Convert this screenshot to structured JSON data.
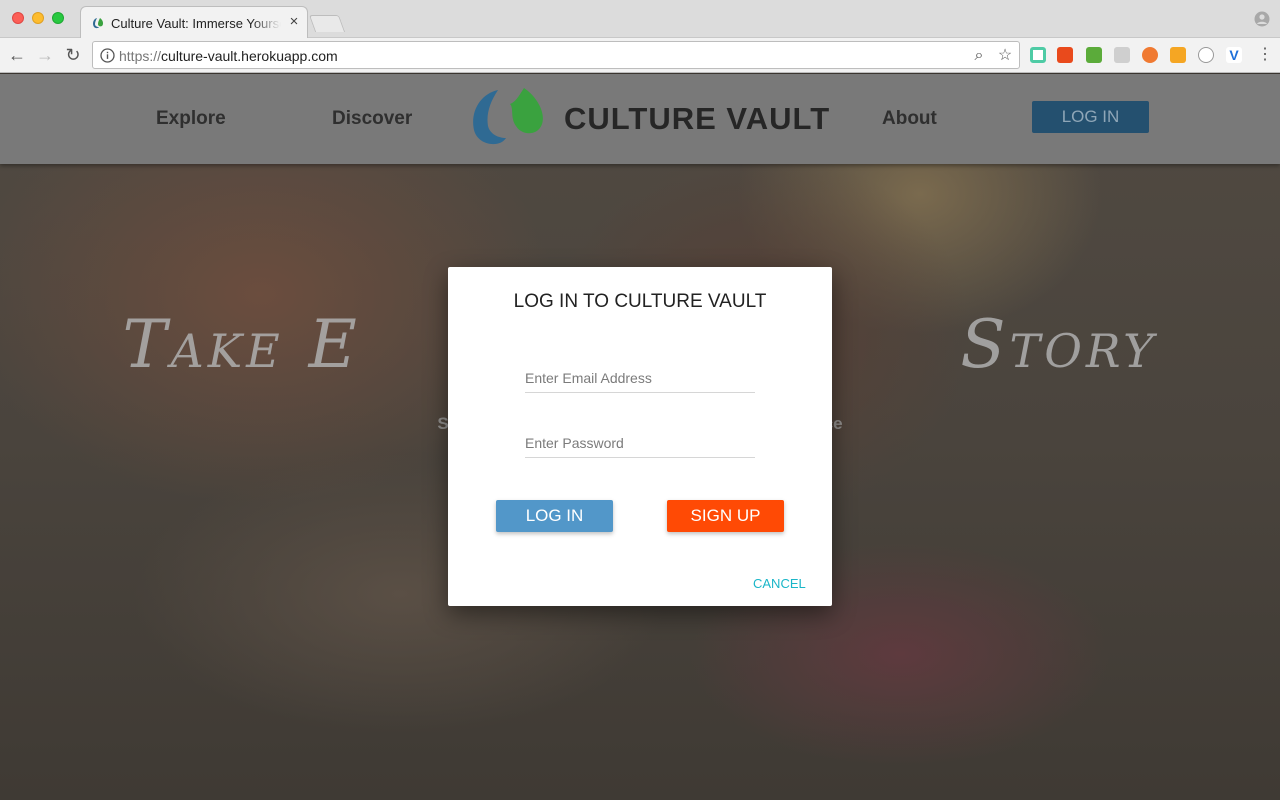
{
  "browser": {
    "tab_title": "Culture Vault: Immerse Yourself",
    "tab_close": "×",
    "url_scheme": "https://",
    "url_host": "culture-vault.herokuapp.com",
    "back_glyph": "←",
    "forward_glyph": "→",
    "reload_glyph": "↻",
    "zoom_glyph": "⌕",
    "star_glyph": "☆",
    "menu_glyph": "⋮"
  },
  "nav": {
    "explore": "Explore",
    "discover": "Discover",
    "brand": "CULTURE VAULT",
    "about": "About",
    "login": "LOG IN"
  },
  "hero": {
    "title": "Take E                        Story",
    "subtitle": "Sha                                                                         nce"
  },
  "modal": {
    "title": "LOG IN TO CULTURE VAULT",
    "email_placeholder": "Enter Email Address",
    "password_placeholder": "Enter Password",
    "login_label": "LOG IN",
    "signup_label": "SIGN UP",
    "cancel_label": "CANCEL"
  },
  "colors": {
    "brand_blue": "#2f6a93",
    "brand_green": "#3aa23f",
    "login_button": "#5297c9",
    "signup_button": "#ff4a05",
    "cancel_text": "#1ab6c8"
  }
}
